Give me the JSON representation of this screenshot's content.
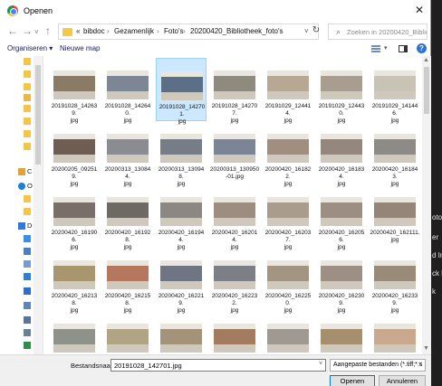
{
  "window": {
    "title": "Openen"
  },
  "address": {
    "overflow": "«",
    "crumbs": [
      "bibdoc",
      "Gezamenlijk",
      "Foto's",
      "20200420_Bibliotheek_foto's"
    ]
  },
  "search": {
    "placeholder": "Zoeken in 20200420_Bibliotheek..."
  },
  "toolbar": {
    "organize": "Organiseren ▾",
    "new_folder": "Nieuwe map"
  },
  "nav_pane": {
    "labels": [
      "C",
      "O",
      "D"
    ]
  },
  "files": [
    [
      "20191028_142639.",
      "jpg"
    ],
    [
      "20191028_142640.",
      "jpg"
    ],
    [
      "20191028_142701.",
      "jpg"
    ],
    [
      "20191028_142707.",
      "jpg"
    ],
    [
      "20191029_124414.",
      "jpg"
    ],
    [
      "20191029_124430.",
      "jpg"
    ],
    [
      "20191029_141446.",
      "jpg"
    ],
    [
      "20200205_092519.",
      "jpg"
    ],
    [
      "20200313_130844.",
      "jpg"
    ],
    [
      "20200313_130948.",
      "jpg"
    ],
    [
      "20200313_130950",
      "-01.jpg"
    ],
    [
      "20200420_161822.",
      "jpg"
    ],
    [
      "20200420_161834.",
      "jpg"
    ],
    [
      "20200420_161843.",
      "jpg"
    ],
    [
      "20200420_161906.",
      "jpg"
    ],
    [
      "20200420_161928.",
      "jpg"
    ],
    [
      "20200420_161944.",
      "jpg"
    ],
    [
      "20200420_162014.",
      "jpg"
    ],
    [
      "20200420_162037.",
      "jpg"
    ],
    [
      "20200420_162056.",
      "jpg"
    ],
    [
      "20200420_162111.",
      "jpg"
    ],
    [
      "20200420_162138.",
      "jpg"
    ],
    [
      "20200420_162158.",
      "jpg"
    ],
    [
      "20200420_162219.",
      "jpg"
    ],
    [
      "20200420_162232.",
      "jpg"
    ],
    [
      "20200420_162250.",
      "jpg"
    ],
    [
      "20200420_162309.",
      "jpg"
    ],
    [
      "20200420_162339.",
      "jpg"
    ],
    [
      "",
      ""
    ],
    [
      "",
      ""
    ],
    [
      "",
      ""
    ],
    [
      "",
      ""
    ],
    [
      "",
      ""
    ],
    [
      "",
      ""
    ],
    [
      "",
      ""
    ]
  ],
  "selected_index": 2,
  "thumb_colors": [
    "#8a7a66",
    "#7d8694",
    "#5b6f86",
    "#8f8a7e",
    "#b7a893",
    "#a99d8f",
    "#c9c3b6",
    "#6d5d52",
    "#8b8c91",
    "#777d86",
    "#7b8595",
    "#a08f80",
    "#94877d",
    "#8e8b86",
    "#7a6e68",
    "#6e6a63",
    "#8c8782",
    "#9c8d80",
    "#aa9c8c",
    "#9d8e84",
    "#948578",
    "#a8966f",
    "#b5785e",
    "#6f7582",
    "#7c8086",
    "#a49582",
    "#9d8f83",
    "#9a8a78",
    "#8f9288",
    "#b0a484",
    "#a39379",
    "#a37b5f",
    "#9e9a92",
    "#a68f6d",
    "#c8a98d"
  ],
  "bottom": {
    "filename_label": "Bestandsnaam:",
    "filename_value": "20191028_142701.jpg",
    "filter_value": "Aangepaste bestanden (*.tiff;*.s",
    "open": "Openen",
    "cancel": "Annuleren"
  },
  "background_window": {
    "snippets": [
      "oto",
      "er",
      "d In",
      "ck b",
      "k"
    ]
  },
  "icons": {
    "back": "arrow-left-icon",
    "forward": "arrow-right-icon",
    "up": "arrow-up-icon",
    "refresh": "refresh-icon",
    "search": "search-icon",
    "close": "close-icon",
    "help": "help-icon"
  }
}
